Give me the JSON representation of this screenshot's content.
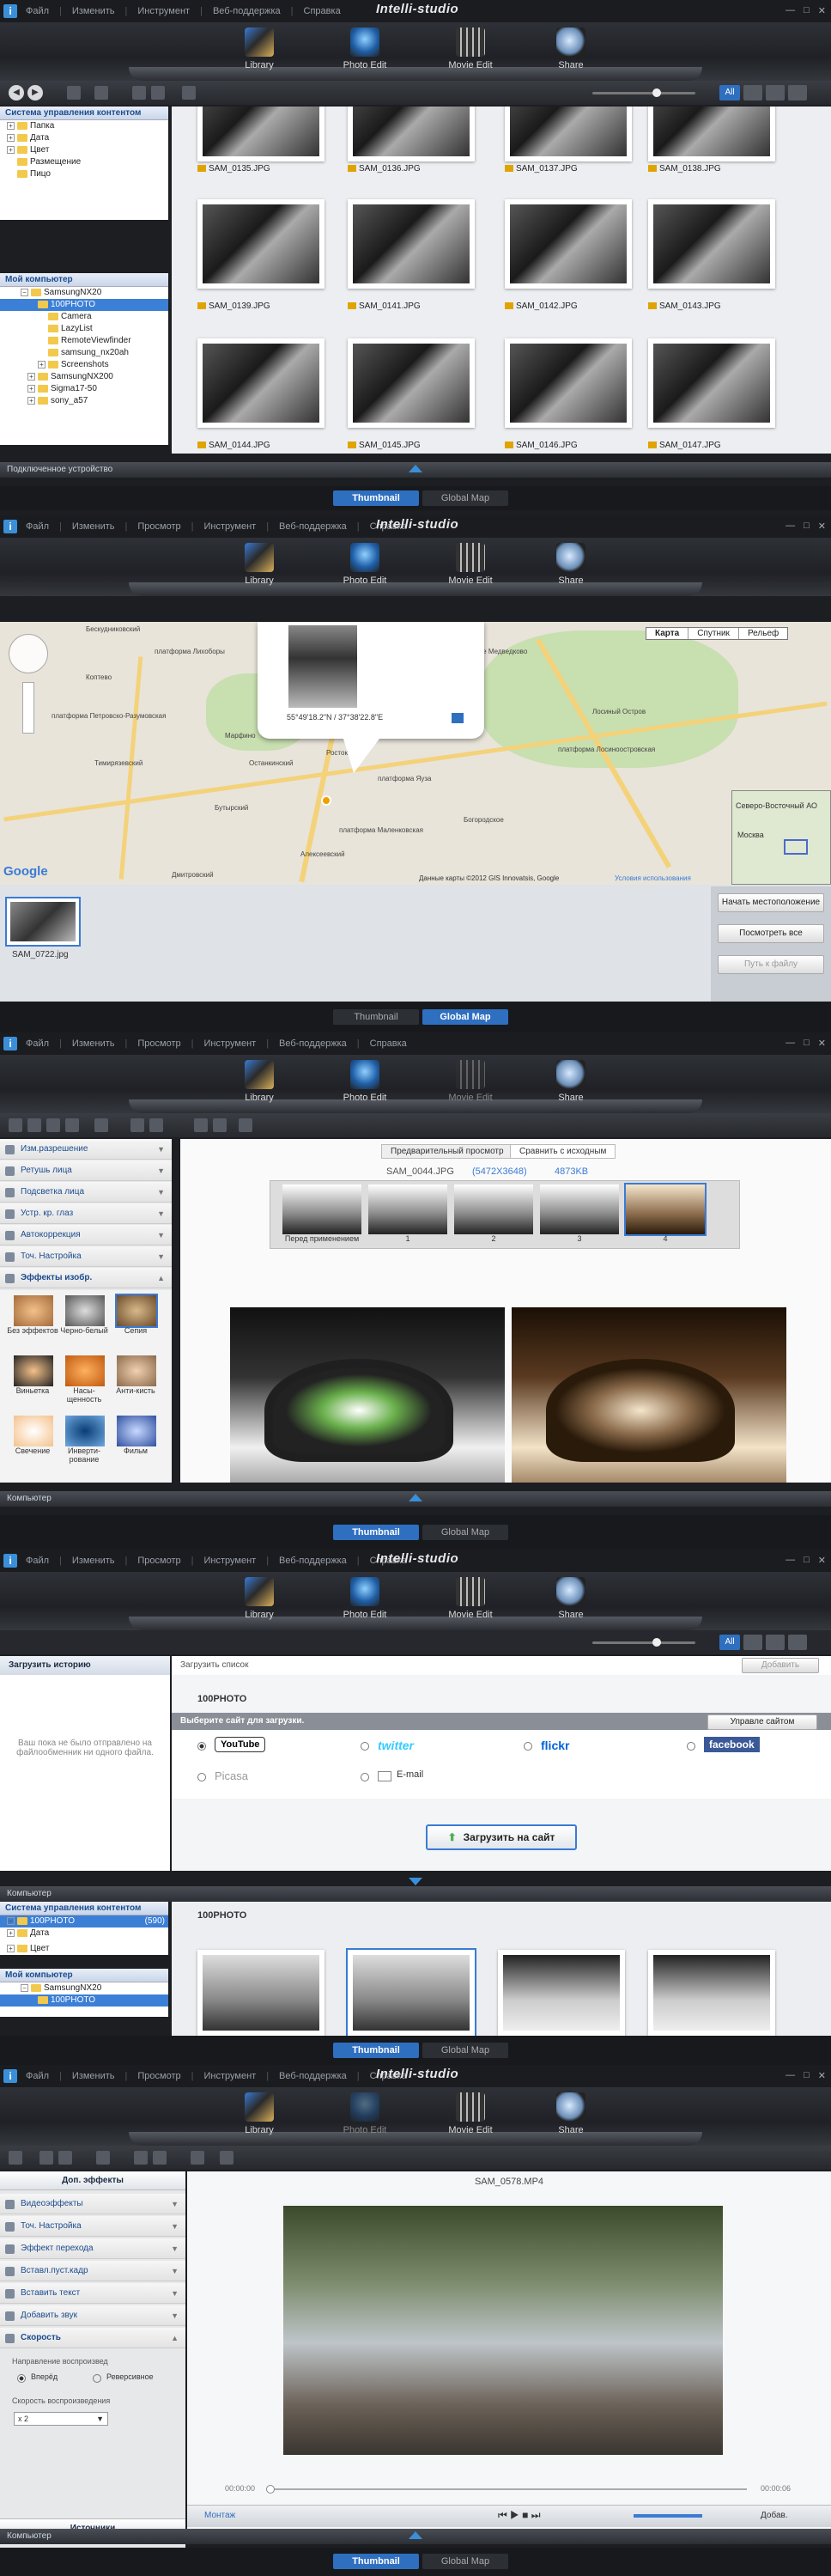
{
  "menu": {
    "items": [
      "Файл",
      "Изменить",
      "Просмотр",
      "Инструмент",
      "Веб-поддержка",
      "Справка"
    ]
  },
  "app_title": "Intelli-studio",
  "modes": [
    "Library",
    "Photo Edit",
    "Movie Edit",
    "Share"
  ],
  "view_tabs": {
    "thumbnail": "Thumbnail",
    "global_map": "Global Map"
  },
  "library": {
    "view_all": "All",
    "tree_header": "Система управления контентом",
    "tree_items": [
      "Папка",
      "Дата",
      "Цвет",
      "Размещение",
      "Пицо"
    ],
    "computer": "Мой компьютер",
    "folders": [
      "SamsungNX20",
      "100PHOTO",
      "Camera",
      "LazyList",
      "RemoteViewfinder",
      "samsung_nx20ah",
      "Screenshots",
      "SamsungNX200",
      "Sigma17-50",
      "sony_a57"
    ],
    "captions": [
      "SAM_0135.JPG",
      "SAM_0136.JPG",
      "SAM_0137.JPG",
      "SAM_0138.JPG",
      "SAM_0139.JPG",
      "SAM_0141.JPG",
      "SAM_0142.JPG",
      "SAM_0143.JPG",
      "SAM_0144.JPG",
      "SAM_0145.JPG",
      "SAM_0146.JPG",
      "SAM_0147.JPG"
    ],
    "status": "Подключенное устройство"
  },
  "map": {
    "types": [
      "Карта",
      "Спутник",
      "Рельеф"
    ],
    "coords": "55°49'18.2\"N / 37°38'22.8\"E",
    "labels": [
      "Бескудниковский",
      "платформа Лихоборы",
      "Коптево",
      "платформа Петровско-Разумовская",
      "Тимирязевский",
      "Марфино",
      "Останкинский",
      "Бутырский",
      "Ростокино",
      "платформа Маленковская",
      "Алексеевский",
      "Лосиный Остров",
      "платформа Яуза",
      "Богородское",
      "платформа Лосиноостровская",
      "Дмитровский",
      "Северное Медведково"
    ],
    "google": "Google",
    "copyright": "Данные карты ©2012 GIS Innovatsis, Google",
    "terms": "Условия использования",
    "inset": "Северо-Восточный АО",
    "inset_city": "Москва",
    "thumb_caption": "SAM_0722.jpg",
    "buttons": [
      "Начать местоположение",
      "Посмотреть все",
      "Путь к файлу"
    ]
  },
  "photo_edit": {
    "tabs": [
      "Предварительный просмотр",
      "Сравнить с исходным"
    ],
    "file": "SAM_0044.JPG",
    "size": "(5472X3648)",
    "kb": "4873KB",
    "strip_labels": [
      "Перед применением",
      "1",
      "2",
      "3",
      "4"
    ],
    "panel_items": [
      "Изм.разрешение",
      "Ретушь лица",
      "Подсветка лица",
      "Устр. кр. глаз",
      "Автокоррекция",
      "Точ. Настройка",
      "Эффекты изобр."
    ],
    "effects": [
      "Без эффектов",
      "Черно-белый",
      "Сепия",
      "Виньетка",
      "Насы-щенность",
      "Анти-кисть",
      "Свечение",
      "Инверти-рование",
      "Фильм"
    ],
    "status": "Компьютер"
  },
  "share": {
    "history_title": "Загрузить историю",
    "history_text": "Ваш пока не было отправлено на файлообменник ни одного файла.",
    "upload_list": "Загрузить список",
    "add": "Добавить",
    "folder": "100PHOTO",
    "choose_site": "Выберите сайт для загрузки.",
    "manage_sites": "Управле сайтом",
    "sites": [
      "YouTube",
      "twitter",
      "flickr",
      "facebook",
      "Picasa",
      "E-mail"
    ],
    "upload_btn": "Загрузить на сайт",
    "computer": "Компьютер",
    "tree_header": "Система управления контентом",
    "tree_items": [
      "100PHOTO",
      "Дата",
      "Цвет"
    ],
    "count": "(590)",
    "my_computer": "Мой компьютер",
    "folders": [
      "SamsungNX20",
      "100PHOTO"
    ],
    "grid_folder": "100PHOTO"
  },
  "movie_edit": {
    "panel_title": "Доп. эффекты",
    "panel_items": [
      "Видеоэффекты",
      "Точ. Настройка",
      "Эффект перехода",
      "Вставл.пуст.кадр",
      "Вставить текст",
      "Добавить звук",
      "Скорость"
    ],
    "direction": "Направление воспроизвед",
    "forward": "Вперёд",
    "reverse": "Реверсивное",
    "speed_label": "Скорость воспроизведения",
    "speed_value": "x 2",
    "sources": "Источники",
    "file": "SAM_0578.MP4",
    "time_start": "00:00:00",
    "time_end": "00:00:06",
    "mount": "Монтаж",
    "add_btn": "Добав.",
    "status": "Компьютер"
  }
}
